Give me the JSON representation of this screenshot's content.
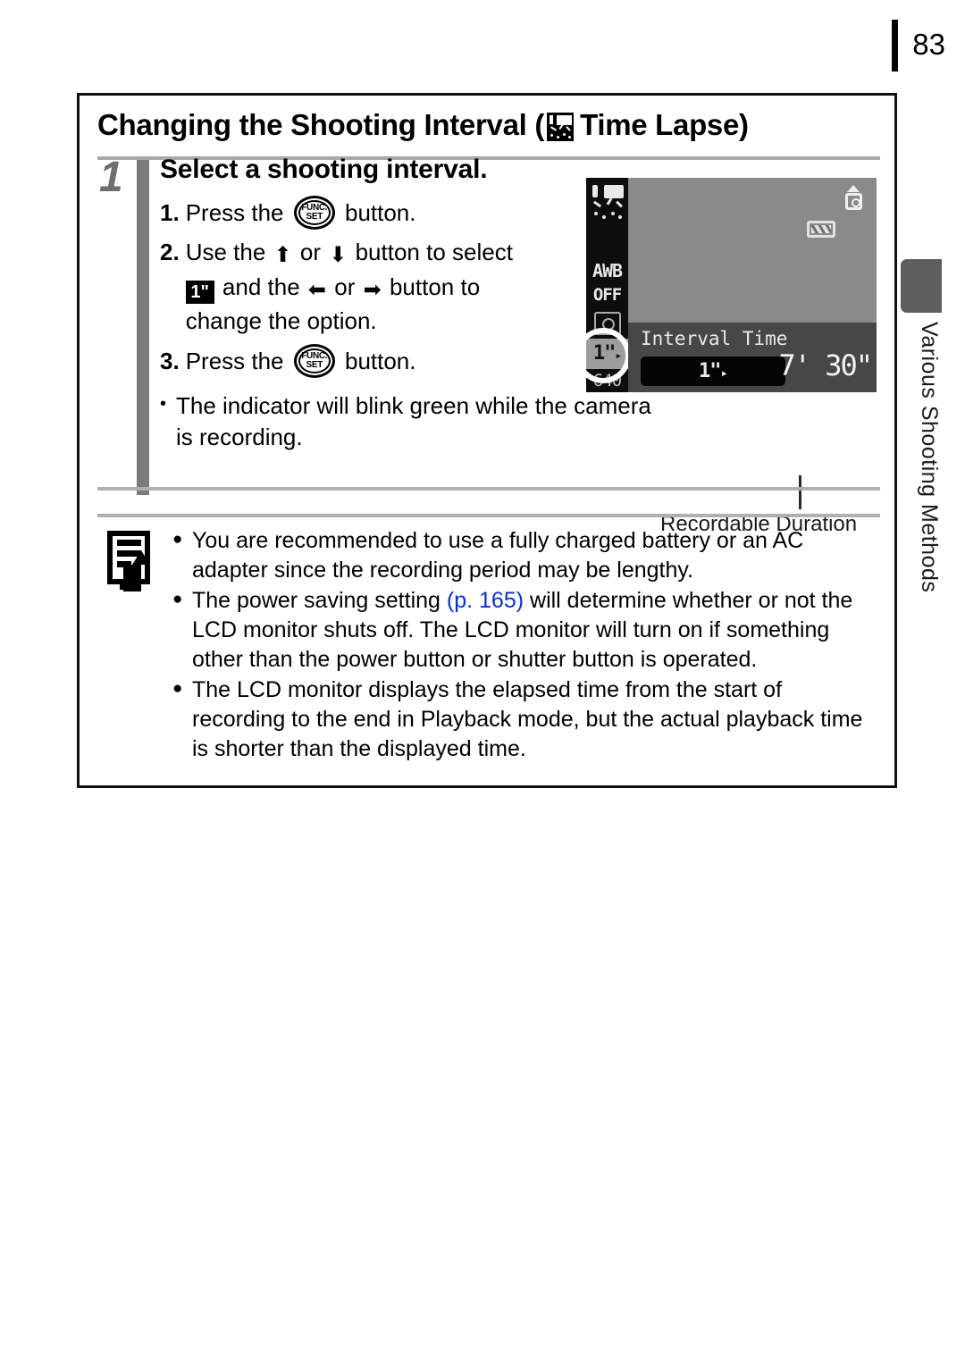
{
  "page": {
    "number": "83",
    "side_tab_label": "Various Shooting Methods"
  },
  "section": {
    "title_before_icon": "Changing the Shooting Interval (",
    "title_icon": "time-lapse-icon",
    "title_after_icon": "Time Lapse)"
  },
  "step": {
    "number": "1",
    "heading": "Select a shooting interval.",
    "substeps": [
      {
        "marker": "1.",
        "text_before": "Press the",
        "button_icon": "func-set-button-icon",
        "button_line1": "FUNC.",
        "button_line2": "SET",
        "text_after": "button."
      },
      {
        "marker": "2.",
        "text_part1": "Use the",
        "arrow_up": "⬆",
        "or_1": "or",
        "arrow_down": "⬇",
        "text_part2": "button to select",
        "badge": "1\"",
        "text_part3": "and the",
        "arrow_left": "⬅",
        "or_2": "or",
        "arrow_right": "➡",
        "text_part4": "button to",
        "text_part5": "change the option."
      },
      {
        "marker": "3.",
        "text_before": "Press the",
        "button_icon": "func-set-button-icon",
        "button_line1": "FUNC.",
        "button_line2": "SET",
        "text_after": "button."
      }
    ],
    "bullet": {
      "dot": "•",
      "text": "The indicator will blink green while the camera is recording."
    }
  },
  "lcd": {
    "sidebar": {
      "timelapse_icon": "time-lapse-icon",
      "white_balance": "AWB",
      "flash": "OFF",
      "drive_icon": "drive-mode-icon",
      "interval_value": "1\"",
      "interval_caret": "▸",
      "resolution": "640"
    },
    "shake_icon": "camera-shake-icon",
    "battery_icon": "battery-icon",
    "info": {
      "label": "Interval Time",
      "value": "1\"",
      "value_caret": "▸",
      "duration": "7' 30\""
    },
    "caption": "Recordable Duration"
  },
  "notes": {
    "icon": "note-memo-icon",
    "items": [
      {
        "dot": "●",
        "text_1": "You are recommended to use a fully charged battery or an AC adapter since the recording period may be lengthy."
      },
      {
        "dot": "●",
        "text_1": "The power saving setting ",
        "page_ref": "(p. 165)",
        "text_2": " will determine whether or not the LCD monitor shuts off. The LCD monitor will turn on if something other than the power button or shutter button is operated."
      },
      {
        "dot": "●",
        "text_1": "The LCD monitor displays the elapsed time from the start of recording to the end in Playback mode, but the actual playback time is shorter than the displayed time."
      }
    ]
  },
  "colors": {
    "page_ref_link": "#0b2fd4",
    "side_tab": "#5e5e5e",
    "step_bar": "#7b7b7b",
    "lcd_background": "#8a8a8a",
    "lcd_infobar": "#474747"
  }
}
